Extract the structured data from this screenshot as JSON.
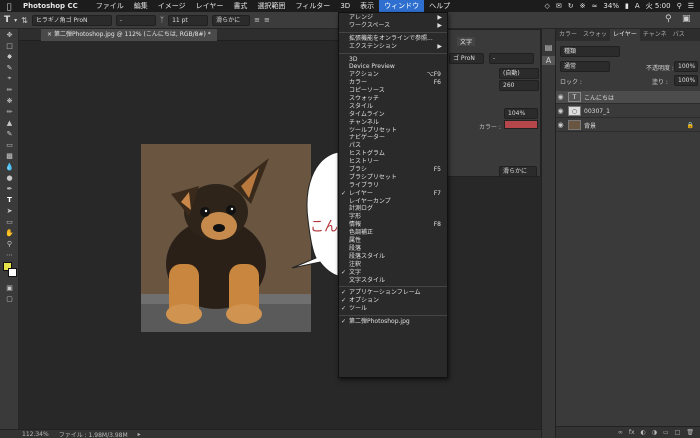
{
  "menubar": {
    "app": "Photoshop CC",
    "items": [
      "ファイル",
      "編集",
      "イメージ",
      "レイヤー",
      "書式",
      "選択範囲",
      "フィルター",
      "3D",
      "表示",
      "ウィンドウ",
      "ヘルプ"
    ],
    "battery": "34%",
    "input": "A",
    "clock": "火 5:00"
  },
  "optbar": {
    "font": "ヒラギノ角ゴ ProN",
    "style": "-",
    "size": "11 pt",
    "aa": "滑らかに"
  },
  "document": {
    "tab_title": "第二弾Photoshop.jpg @ 112% (こんにちは, RGB/8#) *",
    "bubble_text": "こん"
  },
  "status": {
    "zoom": "112.34%",
    "file": "ファイル : 1.98M/3.98M"
  },
  "charpanel": {
    "tab": "文字",
    "font": "ゴ ProN",
    "style": "-",
    "leading": "(自動)",
    "tracking": "260",
    "scale": "104%",
    "color_label": "カラー :",
    "aa": "滑らかに"
  },
  "layers": {
    "tabs": [
      "カラー",
      "スウォッ",
      "レイヤー",
      "チャンネ",
      "パス"
    ],
    "filter": "種類",
    "blend": "通常",
    "opacity_label": "不透明度 :",
    "opacity": "100%",
    "lock_label": "ロック :",
    "fill_label": "塗り :",
    "fill": "100%",
    "rows": [
      "こんにちは",
      "00307_1",
      "背景"
    ]
  },
  "menu": {
    "items": [
      "アレンジ",
      "ワークスペース",
      "拡張機能をオンラインで参照...",
      "エクステンション",
      "3D",
      "Device Preview",
      "アクション",
      "カラー",
      "コピーソース",
      "スウォッチ",
      "スタイル",
      "タイムライン",
      "チャンネル",
      "ツールプリセット",
      "ナビゲーター",
      "パス",
      "ヒストグラム",
      "ヒストリー",
      "ブラシ",
      "ブラシプリセット",
      "ライブラリ",
      "レイヤー",
      "レイヤーカンプ",
      "計測ログ",
      "字形",
      "情報",
      "色調補正",
      "属性",
      "段落",
      "段落スタイル",
      "注釈",
      "文字",
      "文字スタイル",
      "アプリケーションフレーム",
      "オプション",
      "ツール",
      "第二弾Photoshop.jpg"
    ],
    "shortcuts": {
      "actions": "⌥F9",
      "color": "F6",
      "brush": "F5",
      "layers": "F7",
      "info": "F8"
    }
  }
}
